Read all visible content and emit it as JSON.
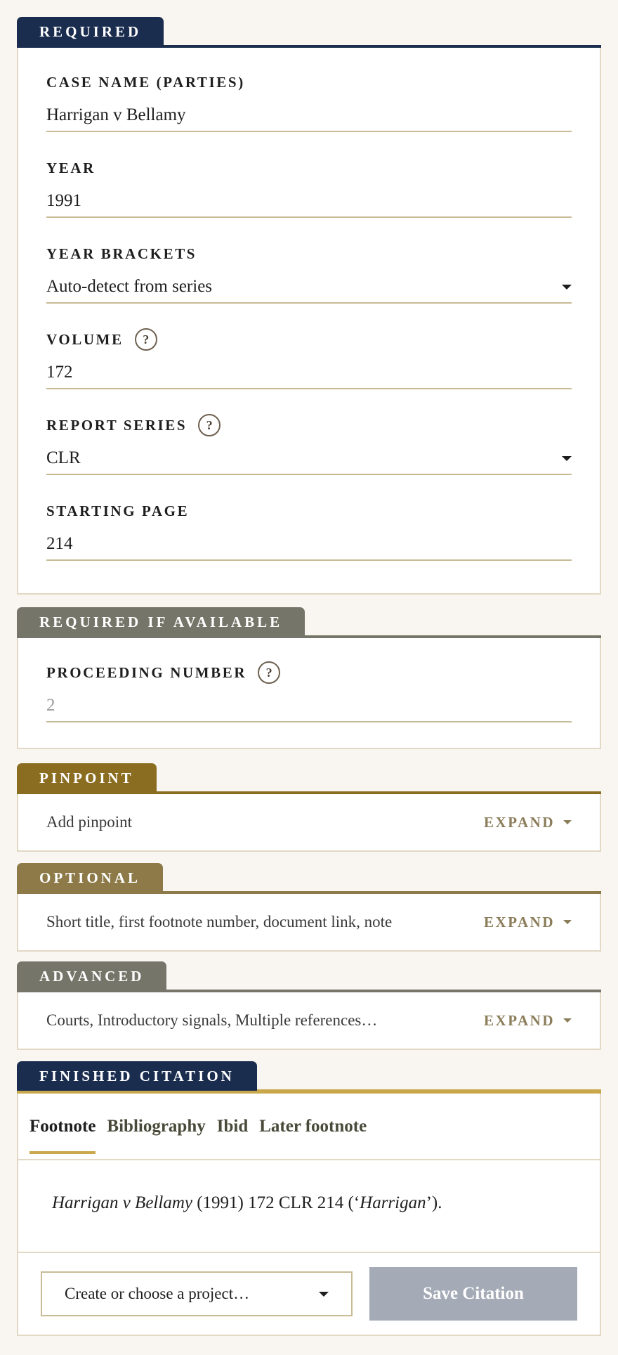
{
  "colors": {
    "navy": "#1b2d4f",
    "gray": "#767569",
    "gold_dark": "#8b6d22",
    "olive": "#8d7a48",
    "gold_rule": "#c9a84c",
    "save_disabled": "#a4aab6"
  },
  "required": {
    "tab_label": "REQUIRED",
    "case_name": {
      "label": "CASE NAME (PARTIES)",
      "value": "Harrigan v Bellamy"
    },
    "year": {
      "label": "YEAR",
      "value": "1991"
    },
    "year_brackets": {
      "label": "YEAR BRACKETS",
      "value": "Auto-detect from series"
    },
    "volume": {
      "label": "VOLUME",
      "help": "?",
      "value": "172"
    },
    "report_series": {
      "label": "REPORT SERIES",
      "help": "?",
      "value": "CLR"
    },
    "starting_page": {
      "label": "STARTING PAGE",
      "value": "214"
    }
  },
  "required_if_available": {
    "tab_label": "REQUIRED IF AVAILABLE",
    "proceeding_number": {
      "label": "PROCEEDING NUMBER",
      "help": "?",
      "placeholder": "2"
    }
  },
  "pinpoint": {
    "tab_label": "PINPOINT",
    "summary": "Add pinpoint",
    "expand_label": "EXPAND"
  },
  "optional": {
    "tab_label": "OPTIONAL",
    "summary": "Short title, first footnote number, document link, note",
    "expand_label": "EXPAND"
  },
  "advanced": {
    "tab_label": "ADVANCED",
    "summary": "Courts, Introductory signals, Multiple references…",
    "expand_label": "EXPAND"
  },
  "finished": {
    "tab_label": "FINISHED CITATION",
    "tabs": [
      "Footnote",
      "Bibliography",
      "Ibid",
      "Later footnote"
    ],
    "citation": {
      "case_italic": "Harrigan v Bellamy",
      "middle": " (1991) 172 CLR 214 (‘",
      "short_italic": "Harrigan",
      "end": "’)."
    },
    "project_select": "Create or choose a project…",
    "save_label": "Save Citation"
  }
}
